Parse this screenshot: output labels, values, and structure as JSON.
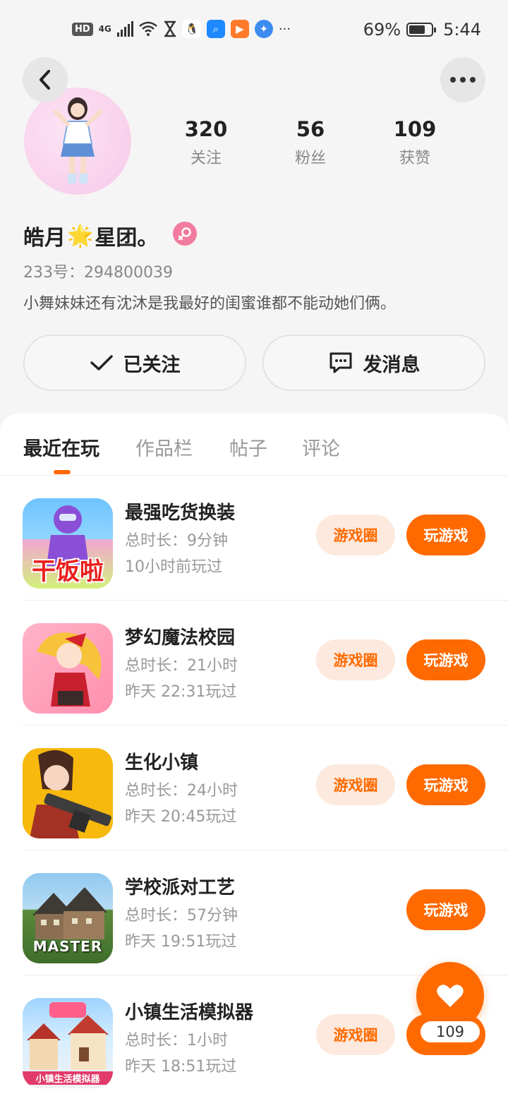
{
  "status_bar": {
    "hd": "HD",
    "network": "4G",
    "battery_percent": "69%",
    "battery_level": 0.69,
    "time": "5:44",
    "notification_icons": [
      "wifi-icon",
      "hourglass-icon",
      "qq-icon",
      "search-app-icon",
      "video-app-icon",
      "browser-icon"
    ],
    "overflow": "···"
  },
  "profile": {
    "stats": [
      {
        "value": "320",
        "label": "关注"
      },
      {
        "value": "56",
        "label": "粉丝"
      },
      {
        "value": "109",
        "label": "获赞"
      }
    ],
    "name_part1": "皓月",
    "name_star": "🌟",
    "name_part2": "星团。",
    "uid": "233号：294800039",
    "bio": "小舞妹妹还有沈沐是我最好的闺蜜谁都不能动她们俩。",
    "follow_label": "已关注",
    "message_label": "发消息"
  },
  "tabs": [
    "最近在玩",
    "作品栏",
    "帖子",
    "评论"
  ],
  "active_tab": "最近在玩",
  "games": [
    {
      "title": "最强吃货换装",
      "duration": "总时长：9分钟",
      "last_played": "10小时前玩过",
      "icon_text": "干饭啦",
      "has_circle": true,
      "circle_label": "游戏圈",
      "play_label": "玩游戏"
    },
    {
      "title": "梦幻魔法校园",
      "duration": "总时长：21小时",
      "last_played": "昨天 22:31玩过",
      "icon_text": "",
      "has_circle": true,
      "circle_label": "游戏圈",
      "play_label": "玩游戏"
    },
    {
      "title": "生化小镇",
      "duration": "总时长：24小时",
      "last_played": "昨天 20:45玩过",
      "icon_text": "",
      "has_circle": true,
      "circle_label": "游戏圈",
      "play_label": "玩游戏"
    },
    {
      "title": "学校派对工艺",
      "duration": "总时长：57分钟",
      "last_played": "昨天 19:51玩过",
      "icon_text": "MASTER",
      "has_circle": false,
      "circle_label": "",
      "play_label": "玩游戏"
    },
    {
      "title": "小镇生活模拟器",
      "duration": "总时长：1小时",
      "last_played": "昨天 18:51玩过",
      "icon_text": "小镇生活模拟器",
      "has_circle": true,
      "circle_label": "游戏圈",
      "play_label": "玩游戏"
    }
  ],
  "like_fab": {
    "count": "109"
  },
  "colors": {
    "accent": "#ff6a00",
    "accent_soft": "#fde9dd",
    "gender_badge": "#f27ba0"
  }
}
